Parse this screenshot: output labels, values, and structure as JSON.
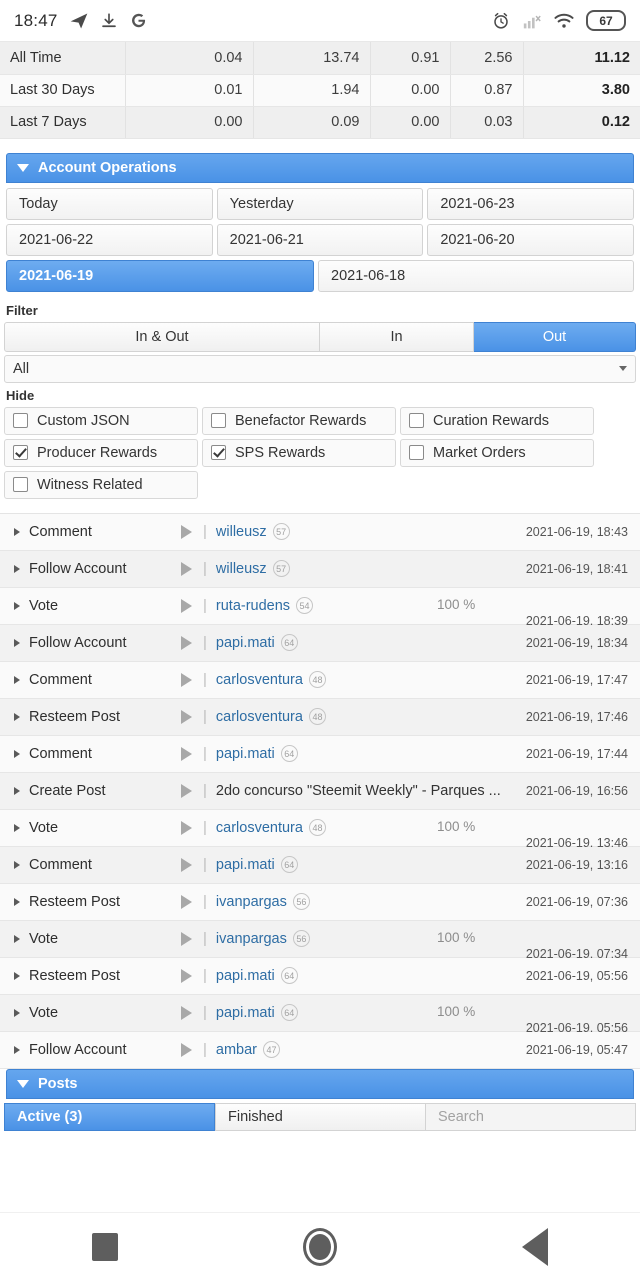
{
  "statusbar": {
    "clock": "18:47",
    "icons_left": [
      "telegram-icon",
      "download-icon",
      "google-icon"
    ],
    "icons_right": [
      "alarm-icon",
      "signal-no-sim-icon",
      "wifi-icon"
    ],
    "battery": "67"
  },
  "summary_table": {
    "rows": [
      {
        "label": "All Time",
        "c1": "0.04",
        "c2": "13.74",
        "c3": "0.91",
        "c4": "2.56",
        "total": "11.12"
      },
      {
        "label": "Last 30 Days",
        "c1": "0.01",
        "c2": "1.94",
        "c3": "0.00",
        "c4": "0.87",
        "total": "3.80"
      },
      {
        "label": "Last 7 Days",
        "c1": "0.00",
        "c2": "0.09",
        "c3": "0.00",
        "c4": "0.03",
        "total": "0.12"
      }
    ]
  },
  "account_operations": {
    "title": "Account Operations",
    "dates": [
      {
        "label": "Today",
        "selected": false
      },
      {
        "label": "Yesterday",
        "selected": false
      },
      {
        "label": "2021-06-23",
        "selected": false
      },
      {
        "label": "2021-06-22",
        "selected": false
      },
      {
        "label": "2021-06-21",
        "selected": false
      },
      {
        "label": "2021-06-20",
        "selected": false
      },
      {
        "label": "2021-06-19",
        "selected": true
      },
      {
        "label": "2021-06-18",
        "selected": false
      }
    ],
    "filter": {
      "label": "Filter",
      "segments": [
        {
          "label": "In & Out",
          "selected": false
        },
        {
          "label": "In",
          "selected": false
        },
        {
          "label": "Out",
          "selected": true
        }
      ],
      "select_value": "All"
    },
    "hide": {
      "label": "Hide",
      "options": [
        {
          "label": "Custom JSON",
          "checked": false
        },
        {
          "label": "Benefactor Rewards",
          "checked": false
        },
        {
          "label": "Curation Rewards",
          "checked": false
        },
        {
          "label": "Producer Rewards",
          "checked": true
        },
        {
          "label": "SPS Rewards",
          "checked": true
        },
        {
          "label": "Market Orders",
          "checked": false
        },
        {
          "label": "Witness Related",
          "checked": false
        }
      ]
    },
    "operations": [
      {
        "op": "Comment",
        "target": "willeusz",
        "rep": "57",
        "link": true,
        "pct": "",
        "time": "2021-06-19, 18:43",
        "time_low": false
      },
      {
        "op": "Follow Account",
        "target": "willeusz",
        "rep": "57",
        "link": true,
        "pct": "",
        "time": "2021-06-19, 18:41",
        "time_low": false
      },
      {
        "op": "Vote",
        "target": "ruta-rudens",
        "rep": "54",
        "link": true,
        "pct": "100 %",
        "time": "2021-06-19, 18:39",
        "time_low": true
      },
      {
        "op": "Follow Account",
        "target": "papi.mati",
        "rep": "64",
        "link": true,
        "pct": "",
        "time": "2021-06-19, 18:34",
        "time_low": false
      },
      {
        "op": "Comment",
        "target": "carlosventura",
        "rep": "48",
        "link": true,
        "pct": "",
        "time": "2021-06-19, 17:47",
        "time_low": false
      },
      {
        "op": "Resteem Post",
        "target": "carlosventura",
        "rep": "48",
        "link": true,
        "pct": "",
        "time": "2021-06-19, 17:46",
        "time_low": false
      },
      {
        "op": "Comment",
        "target": "papi.mati",
        "rep": "64",
        "link": true,
        "pct": "",
        "time": "2021-06-19, 17:44",
        "time_low": false
      },
      {
        "op": "Create Post",
        "target": "2do concurso \"Steemit Weekly\" - Parques ...",
        "rep": "",
        "link": false,
        "pct": "",
        "time": "2021-06-19, 16:56",
        "time_low": false
      },
      {
        "op": "Vote",
        "target": "carlosventura",
        "rep": "48",
        "link": true,
        "pct": "100 %",
        "time": "2021-06-19, 13:46",
        "time_low": true
      },
      {
        "op": "Comment",
        "target": "papi.mati",
        "rep": "64",
        "link": true,
        "pct": "",
        "time": "2021-06-19, 13:16",
        "time_low": false
      },
      {
        "op": "Resteem Post",
        "target": "ivanpargas",
        "rep": "56",
        "link": true,
        "pct": "",
        "time": "2021-06-19, 07:36",
        "time_low": false
      },
      {
        "op": "Vote",
        "target": "ivanpargas",
        "rep": "56",
        "link": true,
        "pct": "100 %",
        "time": "2021-06-19, 07:34",
        "time_low": true
      },
      {
        "op": "Resteem Post",
        "target": "papi.mati",
        "rep": "64",
        "link": true,
        "pct": "",
        "time": "2021-06-19, 05:56",
        "time_low": false
      },
      {
        "op": "Vote",
        "target": "papi.mati",
        "rep": "64",
        "link": true,
        "pct": "100 %",
        "time": "2021-06-19, 05:56",
        "time_low": true
      },
      {
        "op": "Follow Account",
        "target": "ambar",
        "rep": "47",
        "link": true,
        "pct": "",
        "time": "2021-06-19, 05:47",
        "time_low": false
      }
    ]
  },
  "posts": {
    "title": "Posts",
    "tabs": [
      {
        "label": "Active (3)",
        "selected": true
      },
      {
        "label": "Finished",
        "selected": false
      }
    ],
    "search_placeholder": "Search"
  },
  "navbar": {
    "recents": "recents-square-icon",
    "home": "home-circle-icon",
    "back": "back-triangle-icon"
  },
  "colors": {
    "accent": "#4a92e6",
    "link": "#2e6da4",
    "row_light": "#fafafa",
    "row_alt": "#f2f2f2"
  }
}
